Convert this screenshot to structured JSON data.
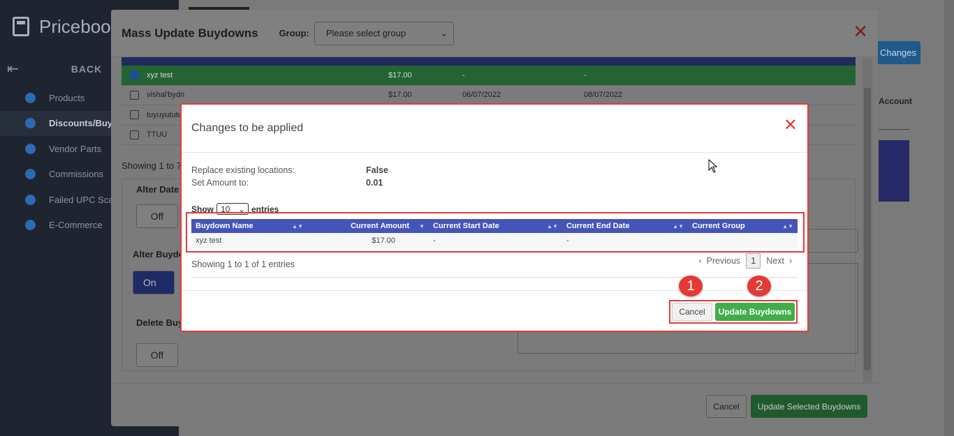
{
  "app": {
    "name": "Priceboo",
    "back_label": "BACK",
    "nav": [
      {
        "label": "Products",
        "icon": "products-icon"
      },
      {
        "label": "Discounts/Buyd",
        "icon": "discounts-icon"
      },
      {
        "label": "Vendor Parts",
        "icon": "truck-icon"
      },
      {
        "label": "Commissions",
        "icon": "commissions-icon"
      },
      {
        "label": "Failed UPC Sca",
        "icon": "barcode-icon"
      },
      {
        "label": "E-Commerce",
        "icon": "ecommerce-icon"
      }
    ],
    "changes_button": "Changes",
    "account_label": "Account"
  },
  "mass_update": {
    "title": "Mass Update Buydowns",
    "group_label": "Group:",
    "group_placeholder": "Please select group",
    "rows": [
      {
        "name": "xyz test",
        "amount": "$17.00",
        "start": "-",
        "end": "-",
        "selected": true
      },
      {
        "name": "vishal'bydn",
        "amount": "$17.00",
        "start": "06/07/2022",
        "end": "08/07/2022",
        "selected": false
      },
      {
        "name": "tuyuyututu",
        "amount": "",
        "start": "",
        "end": "",
        "selected": false
      },
      {
        "name": "TTUU",
        "amount": "",
        "start": "",
        "end": "",
        "selected": false
      }
    ],
    "showing": "Showing 1 to 7",
    "alter_date_label": "Alter Date",
    "alter_date_value": "Off",
    "alter_buydown_label": "Alter Buydo",
    "alter_buydown_value": "On",
    "delete_label": "Delete Buy",
    "delete_value": "Off",
    "cancel_label": "Cancel",
    "update_label": "Update Selected Buydowns"
  },
  "changes_dialog": {
    "title": "Changes to be applied",
    "summary": [
      {
        "label": "Replace existing locations:",
        "value": "False"
      },
      {
        "label": "Set Amount to:",
        "value": "0.01"
      }
    ],
    "show_label": "Show",
    "page_length": "10",
    "entries_label": "entries",
    "columns": [
      "Buydown Name",
      "Current Amount",
      "Current Start Date",
      "Current End Date",
      "Current Group"
    ],
    "rows": [
      {
        "name": "xyz test",
        "amount": "$17.00",
        "start": "-",
        "end": "-",
        "group": ""
      }
    ],
    "showing": "Showing 1 to 1 of 1 entries",
    "prev_label": "Previous",
    "page": "1",
    "next_label": "Next",
    "cancel_label": "Cancel",
    "update_label": "Update Buydowns"
  },
  "callouts": [
    "1",
    "2"
  ],
  "colors": {
    "accent_red": "#e23b3b",
    "header_blue": "#4554b8",
    "update_green": "#3fae49",
    "badge_red": "#e53935"
  }
}
